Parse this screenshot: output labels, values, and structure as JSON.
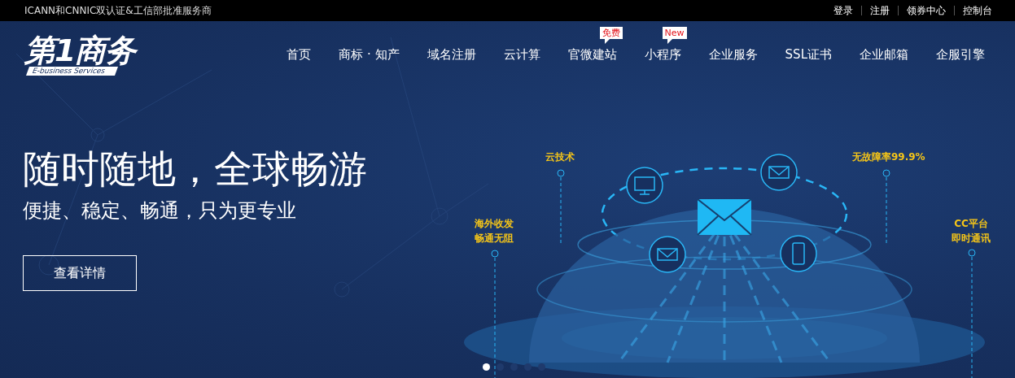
{
  "top_bar": {
    "notice": "ICANN和CNNIC双认证&工信部批准服务商",
    "links": [
      "登录",
      "注册",
      "领券中心",
      "控制台"
    ]
  },
  "header": {
    "logo": {
      "name": "第1商务",
      "tagline": "E-business Services"
    },
    "nav": [
      {
        "label": "首页"
      },
      {
        "label": "商标 · 知产"
      },
      {
        "label": "域名注册"
      },
      {
        "label": "云计算"
      },
      {
        "label": "官微建站",
        "badge": "免费"
      },
      {
        "label": "小程序",
        "badge": "New"
      },
      {
        "label": "企业服务"
      },
      {
        "label": "SSL证书"
      },
      {
        "label": "企业邮箱"
      },
      {
        "label": "企服引擎"
      }
    ]
  },
  "banner": {
    "title": "随时随地，全球畅游",
    "subtitle": "便捷、稳定、畅通，只为更专业",
    "button": "查看详情",
    "features": [
      {
        "lines": [
          "云技术"
        ]
      },
      {
        "lines": [
          "无故障率99.9%"
        ]
      },
      {
        "lines": [
          "海外收发",
          "畅通无阻"
        ]
      },
      {
        "lines": [
          "CC平台",
          "即时通讯"
        ]
      }
    ],
    "slides": [
      {
        "selected": true
      },
      {
        "selected": false
      },
      {
        "selected": false
      },
      {
        "selected": false
      },
      {
        "selected": false
      }
    ]
  }
}
